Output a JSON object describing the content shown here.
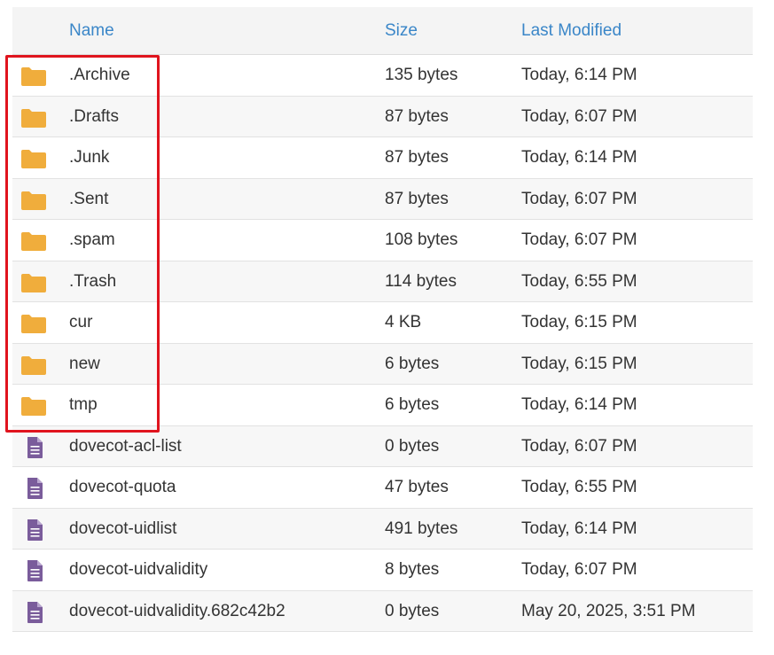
{
  "table": {
    "headers": {
      "name": "Name",
      "size": "Size",
      "modified": "Last Modified"
    },
    "rows": [
      {
        "icon": "folder-icon",
        "name": ".Archive",
        "size": "135 bytes",
        "modified": "Today, 6:14 PM"
      },
      {
        "icon": "folder-icon",
        "name": ".Drafts",
        "size": "87 bytes",
        "modified": "Today, 6:07 PM"
      },
      {
        "icon": "folder-icon",
        "name": ".Junk",
        "size": "87 bytes",
        "modified": "Today, 6:14 PM"
      },
      {
        "icon": "folder-icon",
        "name": ".Sent",
        "size": "87 bytes",
        "modified": "Today, 6:07 PM"
      },
      {
        "icon": "folder-icon",
        "name": ".spam",
        "size": "108 bytes",
        "modified": "Today, 6:07 PM"
      },
      {
        "icon": "folder-icon",
        "name": ".Trash",
        "size": "114 bytes",
        "modified": "Today, 6:55 PM"
      },
      {
        "icon": "folder-icon",
        "name": "cur",
        "size": "4 KB",
        "modified": "Today, 6:15 PM"
      },
      {
        "icon": "folder-icon",
        "name": "new",
        "size": "6 bytes",
        "modified": "Today, 6:15 PM"
      },
      {
        "icon": "folder-icon",
        "name": "tmp",
        "size": "6 bytes",
        "modified": "Today, 6:14 PM"
      },
      {
        "icon": "file-icon",
        "name": "dovecot-acl-list",
        "size": "0 bytes",
        "modified": "Today, 6:07 PM"
      },
      {
        "icon": "file-icon",
        "name": "dovecot-quota",
        "size": "47 bytes",
        "modified": "Today, 6:55 PM"
      },
      {
        "icon": "file-icon",
        "name": "dovecot-uidlist",
        "size": "491 bytes",
        "modified": "Today, 6:14 PM"
      },
      {
        "icon": "file-icon",
        "name": "dovecot-uidvalidity",
        "size": "8 bytes",
        "modified": "Today, 6:07 PM"
      },
      {
        "icon": "file-icon",
        "name": "dovecot-uidvalidity.682c42b2",
        "size": "0 bytes",
        "modified": "May 20, 2025, 3:51 PM"
      }
    ]
  },
  "colors": {
    "header_link": "#3a86c8",
    "folder": "#f0ad3c",
    "file": "#7a5c9b",
    "highlight": "#e0141e"
  }
}
